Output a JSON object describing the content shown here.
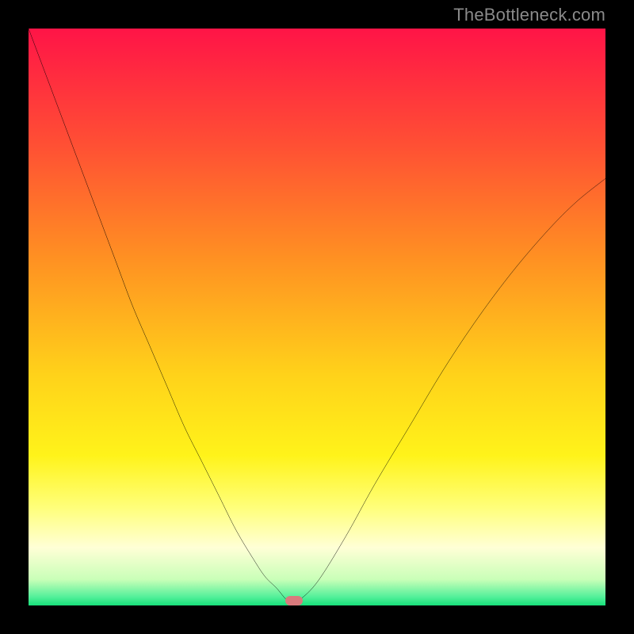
{
  "watermark": {
    "text": "TheBottleneck.com"
  },
  "chart_data": {
    "type": "line",
    "title": "",
    "xlabel": "",
    "ylabel": "",
    "xlim": [
      0,
      100
    ],
    "ylim": [
      0,
      100
    ],
    "grid": false,
    "legend": false,
    "background_gradient_stops": [
      {
        "offset": 0.0,
        "color": "#ff1447"
      },
      {
        "offset": 0.2,
        "color": "#ff4f34"
      },
      {
        "offset": 0.4,
        "color": "#ff9122"
      },
      {
        "offset": 0.6,
        "color": "#ffd21a"
      },
      {
        "offset": 0.74,
        "color": "#fff31a"
      },
      {
        "offset": 0.83,
        "color": "#ffff7a"
      },
      {
        "offset": 0.9,
        "color": "#ffffd6"
      },
      {
        "offset": 0.955,
        "color": "#c9ffb8"
      },
      {
        "offset": 0.985,
        "color": "#54f09a"
      },
      {
        "offset": 1.0,
        "color": "#17e07a"
      }
    ],
    "series": [
      {
        "name": "bottleneck-curve",
        "color": "#000000",
        "x": [
          0,
          3,
          6,
          9,
          12,
          15,
          18,
          21,
          24,
          27,
          30,
          33,
          36,
          39,
          41,
          43,
          44.5,
          45.5,
          46.5,
          50,
          55,
          60,
          66,
          72,
          78,
          84,
          90,
          95,
          100
        ],
        "y": [
          100,
          92,
          84,
          76,
          68,
          60,
          52,
          45,
          38,
          31,
          25,
          19,
          13,
          8,
          5,
          3,
          1.2,
          0.4,
          0.6,
          4,
          12,
          21,
          31,
          41,
          50,
          58,
          65,
          70,
          74
        ]
      }
    ],
    "marker": {
      "x": 46,
      "y": 0.8,
      "color": "#d97a7d"
    }
  }
}
